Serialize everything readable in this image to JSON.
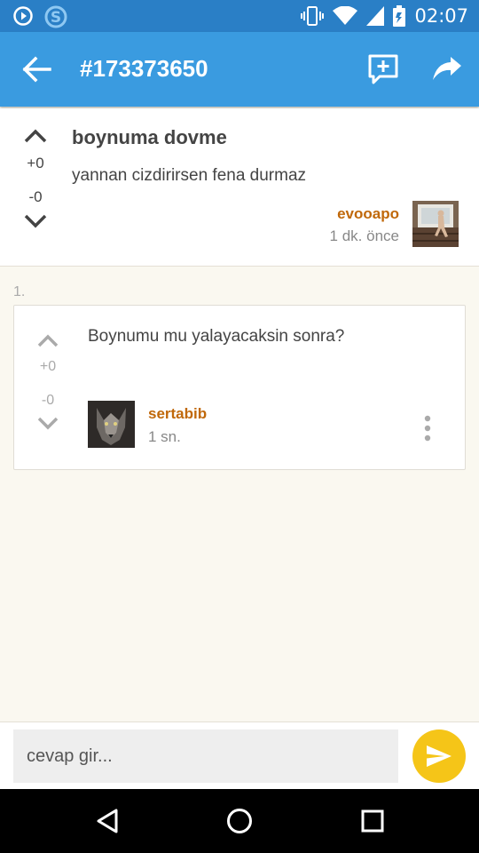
{
  "status_bar": {
    "time": "02:07",
    "icons": [
      "sync-play-icon",
      "s-app-icon",
      "vibrate-icon",
      "wifi-icon",
      "signal-icon",
      "battery-icon"
    ]
  },
  "app_bar": {
    "title": "#173373650",
    "icons": [
      "back-arrow-icon",
      "add-comment-icon",
      "share-icon"
    ]
  },
  "post": {
    "title": "boynuma dovme",
    "body": "yannan cizdirirsen fena durmaz",
    "upvotes": "+0",
    "downvotes": "-0",
    "author": "evooapo",
    "time": "1 dk. önce"
  },
  "comments": [
    {
      "index": "1.",
      "text": "Boynumu mu yalayacaksin sonra?",
      "upvotes": "+0",
      "downvotes": "-0",
      "author": "sertabib",
      "time": "1 sn."
    }
  ],
  "reply": {
    "placeholder": "cevap gir..."
  },
  "colors": {
    "status_bar": "#2a7fc6",
    "app_bar": "#3a9be0",
    "author": "#c0680a",
    "send_button": "#f5c518",
    "background": "#faf8f0"
  }
}
